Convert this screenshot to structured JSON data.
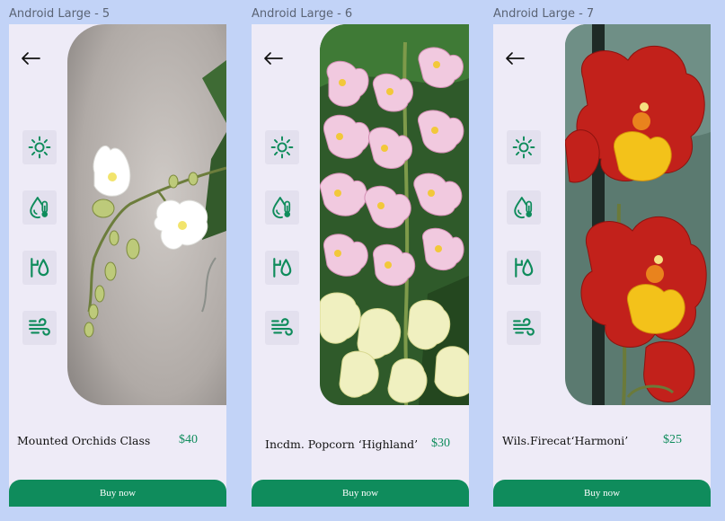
{
  "screens": [
    {
      "frame_label": "Android Large - 5",
      "product_name": "Mounted Orchids Class",
      "price": "$40",
      "buy_label": "Buy now"
    },
    {
      "frame_label": "Android Large - 6",
      "product_name": "Incdm. Popcorn ‘Highland’",
      "price": "$30",
      "buy_label": "Buy now"
    },
    {
      "frame_label": "Android Large - 7",
      "product_name": "Wils.Firecat‘Harmoni’",
      "price": "$25",
      "buy_label": "Buy now"
    }
  ],
  "care_icons": [
    "sun-icon",
    "humidity-temperature-icon",
    "watering-icon",
    "wind-icon"
  ],
  "colors": {
    "accent": "#0f8c5c",
    "background": "#c2d3f7",
    "screen": "#eeebf7",
    "tile": "#e3e0ee"
  }
}
